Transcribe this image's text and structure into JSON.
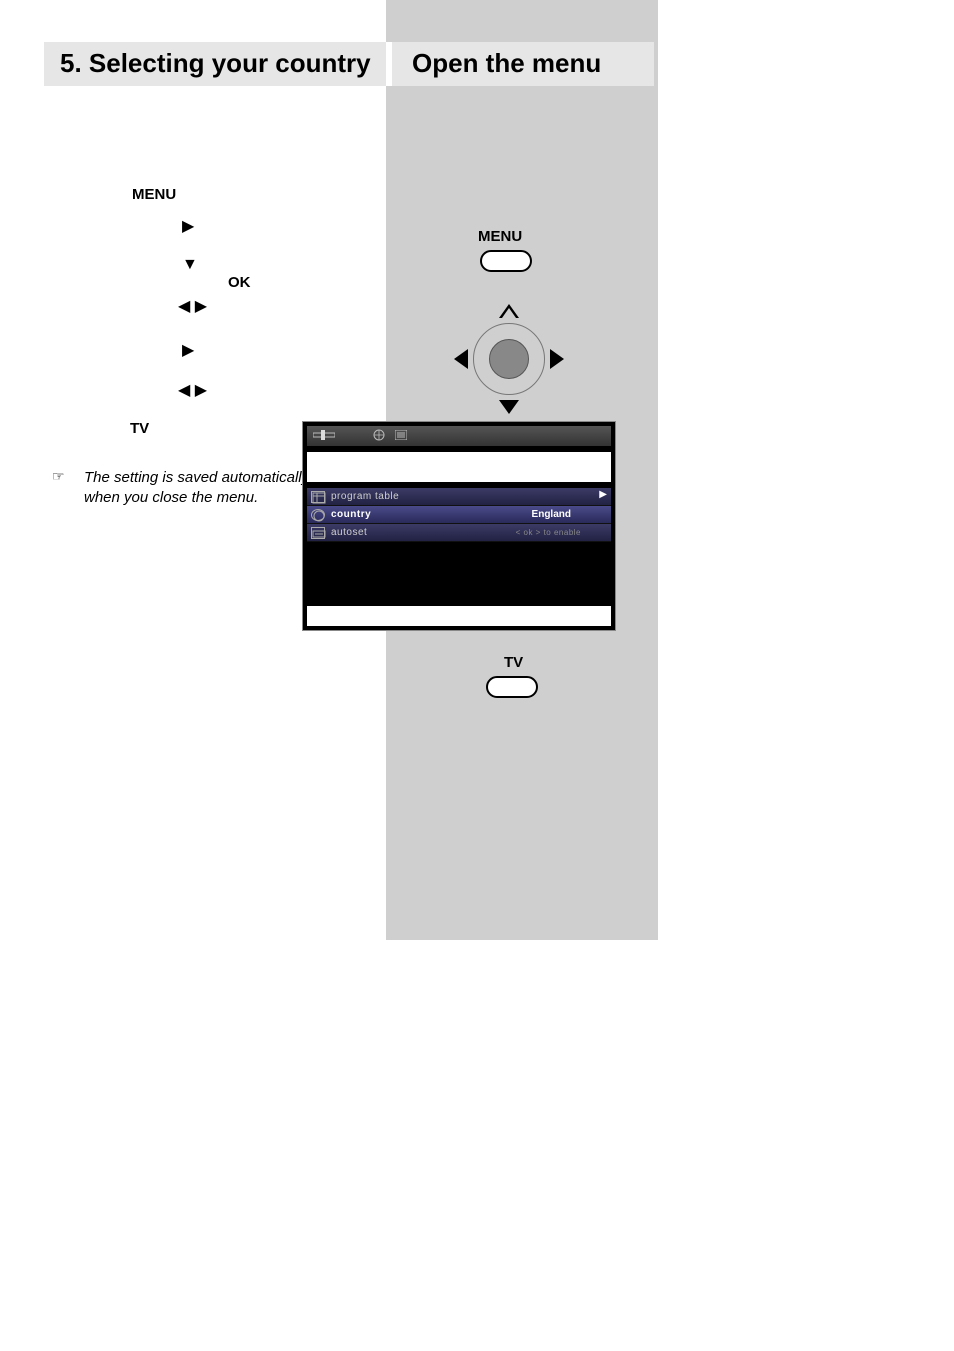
{
  "header": {
    "left_title": "5. Selecting your country",
    "right_title": "Open the menu"
  },
  "left_steps": {
    "menu_label": "MENU",
    "ok_label": "OK",
    "tv_label": "TV"
  },
  "note": {
    "icon": "☞",
    "text": "The setting is saved automatically when you close the menu."
  },
  "right_controls": {
    "menu_label": "MENU",
    "tv_label": "TV"
  },
  "osd": {
    "rows": [
      {
        "label": "program table"
      },
      {
        "label": "country",
        "value": "England",
        "selected": true
      },
      {
        "label": "autoset",
        "hint": "< ok > to enable"
      }
    ]
  }
}
